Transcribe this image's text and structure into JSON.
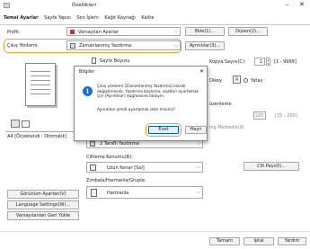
{
  "window": {
    "title": "Özellikleri",
    "minimize_icon": "minimize-icon",
    "close_icon": "close-icon"
  },
  "tabs": [
    "Temel Ayarlar",
    "Sayfa Yapısı",
    "Son İşlem",
    "Kağıt Kaynağı",
    "Kalite"
  ],
  "profile": {
    "label": "Profil:",
    "value": "Varsayılan Ayarlar",
    "edit_label": "Ekle(1)...",
    "change_label": "Düzen(2)..."
  },
  "output_method": {
    "label": "Çıkış Yöntemi:",
    "value": "Zamanlanmış Yazdırma",
    "details_label": "Ayrıntılar(3)..."
  },
  "page_size": {
    "label": "Sayfa Boyutu"
  },
  "copies": {
    "label": "Kopya Sayısı(C):",
    "value": "1",
    "range": "[1 - 9999]"
  },
  "orientation": {
    "portrait": "Dikey",
    "landscape": "Yatay",
    "portrait_glyph": "A",
    "landscape_glyph": "A"
  },
  "right_panel": {
    "edge_label": "üzenleme",
    "size_value": "100",
    "size_range": "[25 - 200]",
    "booklet_label": "ing Merkezle(9)"
  },
  "preview": {
    "caption": "A4 [Ölçeklendi : Otomatik]"
  },
  "print_type": {
    "value": "2 Taraflı Yazdırma"
  },
  "binding": {
    "label": "Ciltleme Konumu(B):",
    "value": "Uzun Kenar [Sol]",
    "margin_label": "Cilt Payı(0)..."
  },
  "staple": {
    "label": "Zımbala/Harmanla/Grupla:",
    "value": "Harmanla"
  },
  "left_buttons": {
    "view_settings": "Görünüm Ayarları(V)",
    "language_settings": "Language Settings(W)...",
    "restore_defaults": "Varsayılanları Geri Yükle"
  },
  "footer": {
    "ok": "Tamam",
    "cancel": "İptal",
    "help": "Yardım"
  },
  "dialog": {
    "title": "Bilgiler",
    "close_icon": "close-icon",
    "info_icon": "info-icon",
    "message": "Çıkış yöntemi [Zamanlanmış Yazdırma] olarak değiştirilecek. Yazdırma başlarsa, saatleri ayarlamak için [Ayrıntılar] düğmesine tıklayın.",
    "question": "Ayrıntıları şimdi ayarlamak ister misiniz?",
    "yes": "Evet",
    "no": "Hayır"
  },
  "colors": {
    "highlight": "#f0a030",
    "info_blue": "#1f6fcf",
    "window_border": "#8a8a8a"
  }
}
